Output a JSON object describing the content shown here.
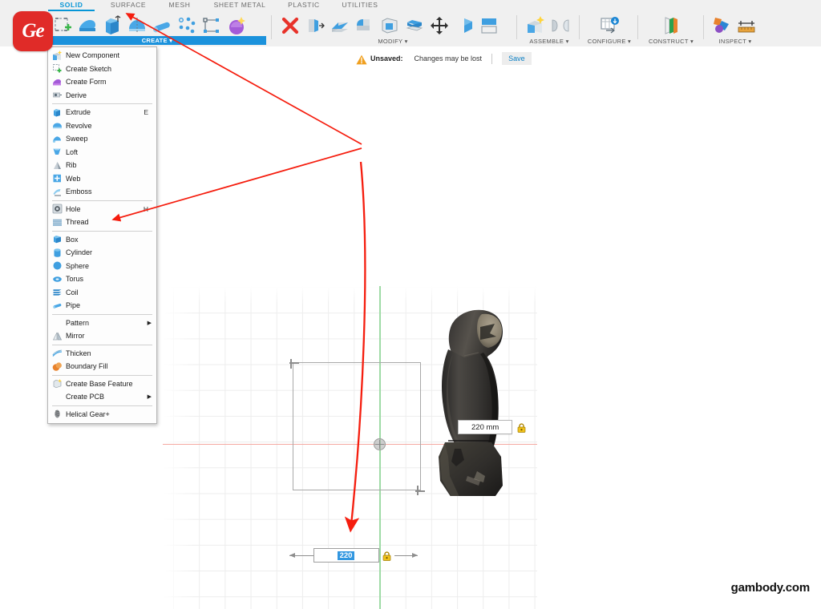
{
  "app": {
    "logo_text": "Ge",
    "watermark": "gambody.com"
  },
  "ribbon": {
    "tabs": [
      {
        "label": "SOLID",
        "active": true
      },
      {
        "label": "SURFACE",
        "active": false
      },
      {
        "label": "MESH",
        "active": false
      },
      {
        "label": "SHEET METAL",
        "active": false
      },
      {
        "label": "PLASTIC",
        "active": false
      },
      {
        "label": "UTILITIES",
        "active": false
      }
    ],
    "groups": [
      {
        "label": "CREATE",
        "label_suffix": " ▾",
        "active": true
      },
      {
        "label": "MODIFY",
        "label_suffix": " ▾",
        "active": false
      },
      {
        "label": "ASSEMBLE",
        "label_suffix": " ▾",
        "active": false
      },
      {
        "label": "CONFIGURE",
        "label_suffix": " ▾",
        "active": false
      },
      {
        "label": "CONSTRUCT",
        "label_suffix": " ▾",
        "active": false
      },
      {
        "label": "INSPECT",
        "label_suffix": " ▾",
        "active": false
      }
    ],
    "icons": {
      "create": [
        "create-sketch-icon",
        "create-form-icon",
        "extrude-icon",
        "revolve-icon",
        "sweep-icon",
        "pattern-icon",
        "web-icon",
        "boundary-fill-icon"
      ],
      "modify": [
        "delete-icon",
        "press-pull-icon",
        "fillet-icon",
        "chamfer-icon",
        "shell-icon",
        "offset-face-icon",
        "move-copy-icon",
        "combine-icon",
        "split-body-icon"
      ],
      "assemble": [
        "new-component-icon",
        "joint-icon"
      ],
      "configure": [
        "configuration-icon"
      ],
      "construct": [
        "offset-plane-icon"
      ],
      "inspect": [
        "interference-icon",
        "measure-icon"
      ]
    }
  },
  "menu": {
    "title": "CREATE",
    "items": [
      {
        "label": "New Component",
        "icon": "new-component-icon",
        "key": "",
        "submenu": false,
        "sep_after": false
      },
      {
        "label": "Create Sketch",
        "icon": "create-sketch-icon",
        "key": "",
        "submenu": false,
        "sep_after": false
      },
      {
        "label": "Create Form",
        "icon": "create-form-icon",
        "key": "",
        "submenu": false,
        "sep_after": false
      },
      {
        "label": "Derive",
        "icon": "derive-icon",
        "key": "",
        "submenu": false,
        "sep_after": true
      },
      {
        "label": "Extrude",
        "icon": "extrude-icon",
        "key": "E",
        "submenu": false,
        "sep_after": false
      },
      {
        "label": "Revolve",
        "icon": "revolve-icon",
        "key": "",
        "submenu": false,
        "sep_after": false
      },
      {
        "label": "Sweep",
        "icon": "sweep-icon",
        "key": "",
        "submenu": false,
        "sep_after": false
      },
      {
        "label": "Loft",
        "icon": "loft-icon",
        "key": "",
        "submenu": false,
        "sep_after": false
      },
      {
        "label": "Rib",
        "icon": "rib-icon",
        "key": "",
        "submenu": false,
        "sep_after": false
      },
      {
        "label": "Web",
        "icon": "web-icon",
        "key": "",
        "submenu": false,
        "sep_after": false
      },
      {
        "label": "Emboss",
        "icon": "emboss-icon",
        "key": "",
        "submenu": false,
        "sep_after": true
      },
      {
        "label": "Hole",
        "icon": "hole-icon",
        "key": "H",
        "submenu": false,
        "sep_after": false
      },
      {
        "label": "Thread",
        "icon": "thread-icon",
        "key": "",
        "submenu": false,
        "sep_after": true
      },
      {
        "label": "Box",
        "icon": "box-icon",
        "key": "",
        "submenu": false,
        "sep_after": false
      },
      {
        "label": "Cylinder",
        "icon": "cylinder-icon",
        "key": "",
        "submenu": false,
        "sep_after": false
      },
      {
        "label": "Sphere",
        "icon": "sphere-icon",
        "key": "",
        "submenu": false,
        "sep_after": false
      },
      {
        "label": "Torus",
        "icon": "torus-icon",
        "key": "",
        "submenu": false,
        "sep_after": false
      },
      {
        "label": "Coil",
        "icon": "coil-icon",
        "key": "",
        "submenu": false,
        "sep_after": false
      },
      {
        "label": "Pipe",
        "icon": "pipe-icon",
        "key": "",
        "submenu": false,
        "sep_after": true
      },
      {
        "label": "Pattern",
        "icon": "",
        "key": "",
        "submenu": true,
        "sep_after": false
      },
      {
        "label": "Mirror",
        "icon": "mirror-icon",
        "key": "",
        "submenu": false,
        "sep_after": true
      },
      {
        "label": "Thicken",
        "icon": "thicken-icon",
        "key": "",
        "submenu": false,
        "sep_after": false
      },
      {
        "label": "Boundary Fill",
        "icon": "boundary-fill-icon",
        "key": "",
        "submenu": false,
        "sep_after": true
      },
      {
        "label": "Create Base Feature",
        "icon": "create-base-feature-icon",
        "key": "",
        "submenu": false,
        "sep_after": false
      },
      {
        "label": "Create PCB",
        "icon": "",
        "key": "",
        "submenu": true,
        "sep_after": true
      },
      {
        "label": "Helical Gear+",
        "icon": "helical-gear-icon",
        "key": "",
        "submenu": false,
        "sep_after": false
      }
    ]
  },
  "notification": {
    "icon": "warning-icon",
    "status_label": "Unsaved:",
    "message": "Changes may be lost",
    "save_label": "Save"
  },
  "canvas": {
    "dimension_height": {
      "value": "220 mm",
      "locked": true,
      "lock_icon": "lock-icon"
    },
    "dimension_width": {
      "value": "220",
      "locked": true,
      "lock_icon": "lock-icon",
      "selected": true
    },
    "model_name": "mesh-body",
    "axis_x_color": "#f4a9a2",
    "axis_y_color": "#9fdba6",
    "grid_color": "#ededed"
  },
  "annotations": {
    "arrow_color": "#f51d0e",
    "arrows": [
      {
        "name": "arrow-to-solid-tab",
        "target": "SOLID"
      },
      {
        "name": "arrow-to-box-menu-item",
        "target": "Box"
      },
      {
        "name": "arrow-to-width-dimension",
        "target": "220"
      }
    ]
  },
  "colors": {
    "accent_blue": "#0696d7",
    "group_active_blue": "#1b92dc",
    "logo_red": "#e02b28",
    "selection_blue": "#3297e0"
  }
}
